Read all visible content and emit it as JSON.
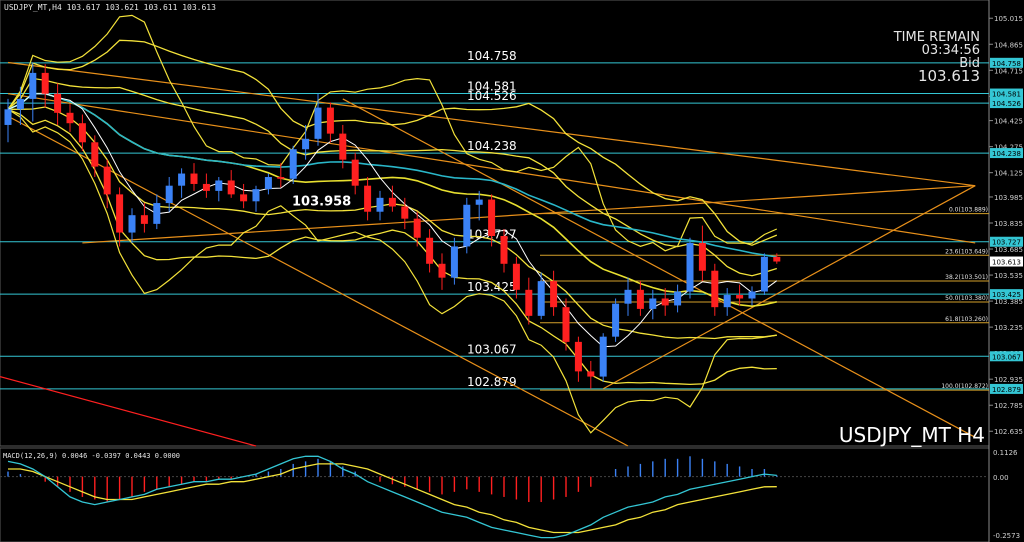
{
  "header": {
    "symbol_info": "USDJPY_MT,H4  103.617 103.621 103.611 103.613"
  },
  "overlay": {
    "time_remain_label": "TIME REMAIN",
    "time_remain_value": "03:34:56",
    "bid_label": "Bid",
    "bid_value": "103.613",
    "watermark": "USDJPY_MT H4"
  },
  "macd_panel": {
    "label": "MACD(12,26,9) 0.0046 -0.0397 0.0443 0.0000",
    "y_ticks": [
      "0.1126",
      "0.00",
      "-0.2573"
    ]
  },
  "colors": {
    "background": "#000000",
    "bull_candle": "#3b82f6",
    "bear_candle": "#ff2020",
    "bollinger": "#f3e23a",
    "moving_average_1": "#ffffff",
    "moving_average_2": "#e8e030",
    "cyan_ma": "#2ab7c9",
    "trendline": "#e8901a",
    "fibo": "#d4a02a",
    "level_line": "#34c6d4",
    "macd_hist_pos": "#3b82f6",
    "macd_hist_neg": "#ff2020",
    "macd_signal": "#f3e23a",
    "macd_line": "#34c6d4",
    "axis_text": "#cfcfcf"
  },
  "chart_data": [
    {
      "type": "candlestick",
      "title": "USDJPY_MT H4",
      "ylim": [
        102.55,
        105.12
      ],
      "y_ticks": [
        "105.015",
        "104.865",
        "104.715",
        "104.565",
        "104.425",
        "104.275",
        "104.125",
        "103.985",
        "103.835",
        "103.685",
        "103.535",
        "103.385",
        "103.235",
        "103.085",
        "102.935",
        "102.785",
        "102.635"
      ],
      "current_price": "103.613",
      "horizontal_levels": [
        {
          "value": 104.758,
          "label": "104.758",
          "tag": "104.758"
        },
        {
          "value": 104.581,
          "label": "104.581",
          "tag": "104.581"
        },
        {
          "value": 104.526,
          "label": "104.526",
          "tag": "104.526"
        },
        {
          "value": 104.238,
          "label": "104.238",
          "tag": "104.238"
        },
        {
          "value": 103.727,
          "label": "103.727",
          "tag": "103.727"
        },
        {
          "value": 103.425,
          "label": "103.425",
          "tag": "103.425"
        },
        {
          "value": 103.067,
          "label": "103.067",
          "tag": "103.067"
        },
        {
          "value": 102.879,
          "label": "102.879",
          "tag": "102.879"
        }
      ],
      "price_annotation": "103.958",
      "fibonacci": [
        {
          "value": 103.889,
          "label": "0.0(103.889)"
        },
        {
          "value": 103.649,
          "label": "23.6(103.649)"
        },
        {
          "value": 103.501,
          "label": "38.2(103.501)"
        },
        {
          "value": 103.38,
          "label": "50.0(103.380)"
        },
        {
          "value": 103.26,
          "label": "61.8(103.260)"
        },
        {
          "value": 102.872,
          "label": "100.0(102.872)"
        }
      ],
      "candles": [
        {
          "o": 104.4,
          "h": 104.55,
          "l": 104.3,
          "c": 104.49
        },
        {
          "o": 104.49,
          "h": 104.62,
          "l": 104.4,
          "c": 104.55
        },
        {
          "o": 104.55,
          "h": 104.76,
          "l": 104.42,
          "c": 104.7
        },
        {
          "o": 104.7,
          "h": 104.75,
          "l": 104.5,
          "c": 104.58
        },
        {
          "o": 104.58,
          "h": 104.64,
          "l": 104.4,
          "c": 104.47
        },
        {
          "o": 104.47,
          "h": 104.52,
          "l": 104.36,
          "c": 104.41
        },
        {
          "o": 104.41,
          "h": 104.46,
          "l": 104.25,
          "c": 104.3
        },
        {
          "o": 104.3,
          "h": 104.34,
          "l": 104.1,
          "c": 104.16
        },
        {
          "o": 104.16,
          "h": 104.2,
          "l": 103.92,
          "c": 104.0
        },
        {
          "o": 104.0,
          "h": 104.04,
          "l": 103.7,
          "c": 103.78
        },
        {
          "o": 103.78,
          "h": 103.92,
          "l": 103.72,
          "c": 103.88
        },
        {
          "o": 103.88,
          "h": 103.95,
          "l": 103.78,
          "c": 103.83
        },
        {
          "o": 103.83,
          "h": 104.0,
          "l": 103.8,
          "c": 103.95
        },
        {
          "o": 103.95,
          "h": 104.1,
          "l": 103.9,
          "c": 104.05
        },
        {
          "o": 104.05,
          "h": 104.15,
          "l": 103.98,
          "c": 104.12
        },
        {
          "o": 104.12,
          "h": 104.18,
          "l": 104.02,
          "c": 104.06
        },
        {
          "o": 104.06,
          "h": 104.12,
          "l": 103.98,
          "c": 104.02
        },
        {
          "o": 104.02,
          "h": 104.1,
          "l": 103.96,
          "c": 104.08
        },
        {
          "o": 104.08,
          "h": 104.14,
          "l": 103.98,
          "c": 104.0
        },
        {
          "o": 104.0,
          "h": 104.06,
          "l": 103.92,
          "c": 103.96
        },
        {
          "o": 103.96,
          "h": 104.05,
          "l": 103.9,
          "c": 104.03
        },
        {
          "o": 104.03,
          "h": 104.12,
          "l": 104.0,
          "c": 104.1
        },
        {
          "o": 104.1,
          "h": 104.18,
          "l": 104.04,
          "c": 104.09
        },
        {
          "o": 104.09,
          "h": 104.28,
          "l": 104.06,
          "c": 104.26
        },
        {
          "o": 104.26,
          "h": 104.4,
          "l": 104.2,
          "c": 104.32
        },
        {
          "o": 104.32,
          "h": 104.58,
          "l": 104.28,
          "c": 104.5
        },
        {
          "o": 104.5,
          "h": 104.53,
          "l": 104.3,
          "c": 104.35
        },
        {
          "o": 104.35,
          "h": 104.4,
          "l": 104.15,
          "c": 104.2
        },
        {
          "o": 104.2,
          "h": 104.24,
          "l": 104.0,
          "c": 104.05
        },
        {
          "o": 104.05,
          "h": 104.1,
          "l": 103.85,
          "c": 103.9
        },
        {
          "o": 103.9,
          "h": 104.02,
          "l": 103.85,
          "c": 103.98
        },
        {
          "o": 103.98,
          "h": 104.05,
          "l": 103.9,
          "c": 103.93
        },
        {
          "o": 103.93,
          "h": 103.98,
          "l": 103.8,
          "c": 103.86
        },
        {
          "o": 103.86,
          "h": 103.9,
          "l": 103.7,
          "c": 103.75
        },
        {
          "o": 103.75,
          "h": 103.8,
          "l": 103.55,
          "c": 103.6
        },
        {
          "o": 103.6,
          "h": 103.66,
          "l": 103.45,
          "c": 103.52
        },
        {
          "o": 103.52,
          "h": 103.75,
          "l": 103.48,
          "c": 103.7
        },
        {
          "o": 103.7,
          "h": 103.98,
          "l": 103.66,
          "c": 103.94
        },
        {
          "o": 103.94,
          "h": 104.02,
          "l": 103.85,
          "c": 103.97
        },
        {
          "o": 103.97,
          "h": 104.0,
          "l": 103.7,
          "c": 103.76
        },
        {
          "o": 103.76,
          "h": 103.8,
          "l": 103.55,
          "c": 103.6
        },
        {
          "o": 103.6,
          "h": 103.64,
          "l": 103.4,
          "c": 103.45
        },
        {
          "o": 103.45,
          "h": 103.52,
          "l": 103.25,
          "c": 103.3
        },
        {
          "o": 103.3,
          "h": 103.55,
          "l": 103.28,
          "c": 103.5
        },
        {
          "o": 103.5,
          "h": 103.56,
          "l": 103.3,
          "c": 103.35
        },
        {
          "o": 103.35,
          "h": 103.4,
          "l": 103.1,
          "c": 103.15
        },
        {
          "o": 103.15,
          "h": 103.18,
          "l": 102.92,
          "c": 102.98
        },
        {
          "o": 102.98,
          "h": 103.04,
          "l": 102.88,
          "c": 102.95
        },
        {
          "o": 102.95,
          "h": 103.2,
          "l": 102.92,
          "c": 103.18
        },
        {
          "o": 103.18,
          "h": 103.4,
          "l": 103.15,
          "c": 103.37
        },
        {
          "o": 103.37,
          "h": 103.52,
          "l": 103.3,
          "c": 103.45
        },
        {
          "o": 103.45,
          "h": 103.5,
          "l": 103.3,
          "c": 103.34
        },
        {
          "o": 103.34,
          "h": 103.45,
          "l": 103.28,
          "c": 103.4
        },
        {
          "o": 103.4,
          "h": 103.46,
          "l": 103.3,
          "c": 103.36
        },
        {
          "o": 103.36,
          "h": 103.48,
          "l": 103.32,
          "c": 103.44
        },
        {
          "o": 103.44,
          "h": 103.75,
          "l": 103.4,
          "c": 103.72
        },
        {
          "o": 103.72,
          "h": 103.82,
          "l": 103.5,
          "c": 103.56
        },
        {
          "o": 103.56,
          "h": 103.6,
          "l": 103.3,
          "c": 103.35
        },
        {
          "o": 103.35,
          "h": 103.46,
          "l": 103.3,
          "c": 103.42
        },
        {
          "o": 103.42,
          "h": 103.48,
          "l": 103.36,
          "c": 103.4
        },
        {
          "o": 103.4,
          "h": 103.47,
          "l": 103.36,
          "c": 103.44
        },
        {
          "o": 103.44,
          "h": 103.66,
          "l": 103.42,
          "c": 103.64
        },
        {
          "o": 103.64,
          "h": 103.66,
          "l": 103.6,
          "c": 103.613
        }
      ]
    },
    {
      "type": "macd",
      "ylim": [
        -0.2573,
        0.1126
      ],
      "histogram": [
        0.02,
        0.01,
        0.0,
        -0.02,
        -0.04,
        -0.06,
        -0.08,
        -0.09,
        -0.1,
        -0.09,
        -0.08,
        -0.06,
        -0.05,
        -0.04,
        -0.03,
        -0.02,
        -0.02,
        -0.01,
        -0.01,
        0.0,
        0.01,
        0.02,
        0.03,
        0.05,
        0.06,
        0.07,
        0.06,
        0.04,
        0.02,
        0.0,
        -0.02,
        -0.03,
        -0.04,
        -0.05,
        -0.06,
        -0.07,
        -0.06,
        -0.05,
        -0.06,
        -0.07,
        -0.08,
        -0.09,
        -0.1,
        -0.1,
        -0.09,
        -0.08,
        -0.06,
        -0.04,
        0.0,
        0.03,
        0.04,
        0.05,
        0.06,
        0.07,
        0.07,
        0.08,
        0.07,
        0.06,
        0.05,
        0.04,
        0.03,
        0.03,
        0.0046
      ],
      "macd_line": [
        0.06,
        0.05,
        0.03,
        0.0,
        -0.04,
        -0.08,
        -0.1,
        -0.11,
        -0.1,
        -0.09,
        -0.08,
        -0.07,
        -0.05,
        -0.04,
        -0.03,
        -0.02,
        -0.02,
        -0.01,
        -0.01,
        0.0,
        0.01,
        0.03,
        0.05,
        0.07,
        0.08,
        0.08,
        0.06,
        0.03,
        0.01,
        -0.02,
        -0.04,
        -0.06,
        -0.08,
        -0.1,
        -0.12,
        -0.14,
        -0.15,
        -0.16,
        -0.18,
        -0.2,
        -0.21,
        -0.22,
        -0.23,
        -0.24,
        -0.24,
        -0.23,
        -0.21,
        -0.19,
        -0.16,
        -0.14,
        -0.12,
        -0.11,
        -0.1,
        -0.08,
        -0.07,
        -0.05,
        -0.04,
        -0.03,
        -0.02,
        -0.01,
        0.0,
        0.01,
        0.0046
      ],
      "signal_line": [
        0.03,
        0.03,
        0.02,
        0.0,
        -0.02,
        -0.04,
        -0.06,
        -0.08,
        -0.09,
        -0.09,
        -0.09,
        -0.08,
        -0.07,
        -0.06,
        -0.05,
        -0.04,
        -0.03,
        -0.03,
        -0.02,
        -0.02,
        -0.01,
        0.0,
        0.01,
        0.03,
        0.04,
        0.05,
        0.05,
        0.05,
        0.04,
        0.03,
        0.01,
        -0.01,
        -0.03,
        -0.05,
        -0.07,
        -0.09,
        -0.11,
        -0.12,
        -0.14,
        -0.15,
        -0.17,
        -0.18,
        -0.2,
        -0.21,
        -0.22,
        -0.22,
        -0.22,
        -0.21,
        -0.2,
        -0.19,
        -0.17,
        -0.16,
        -0.14,
        -0.13,
        -0.11,
        -0.1,
        -0.09,
        -0.08,
        -0.07,
        -0.06,
        -0.05,
        -0.04,
        -0.0397
      ]
    }
  ]
}
